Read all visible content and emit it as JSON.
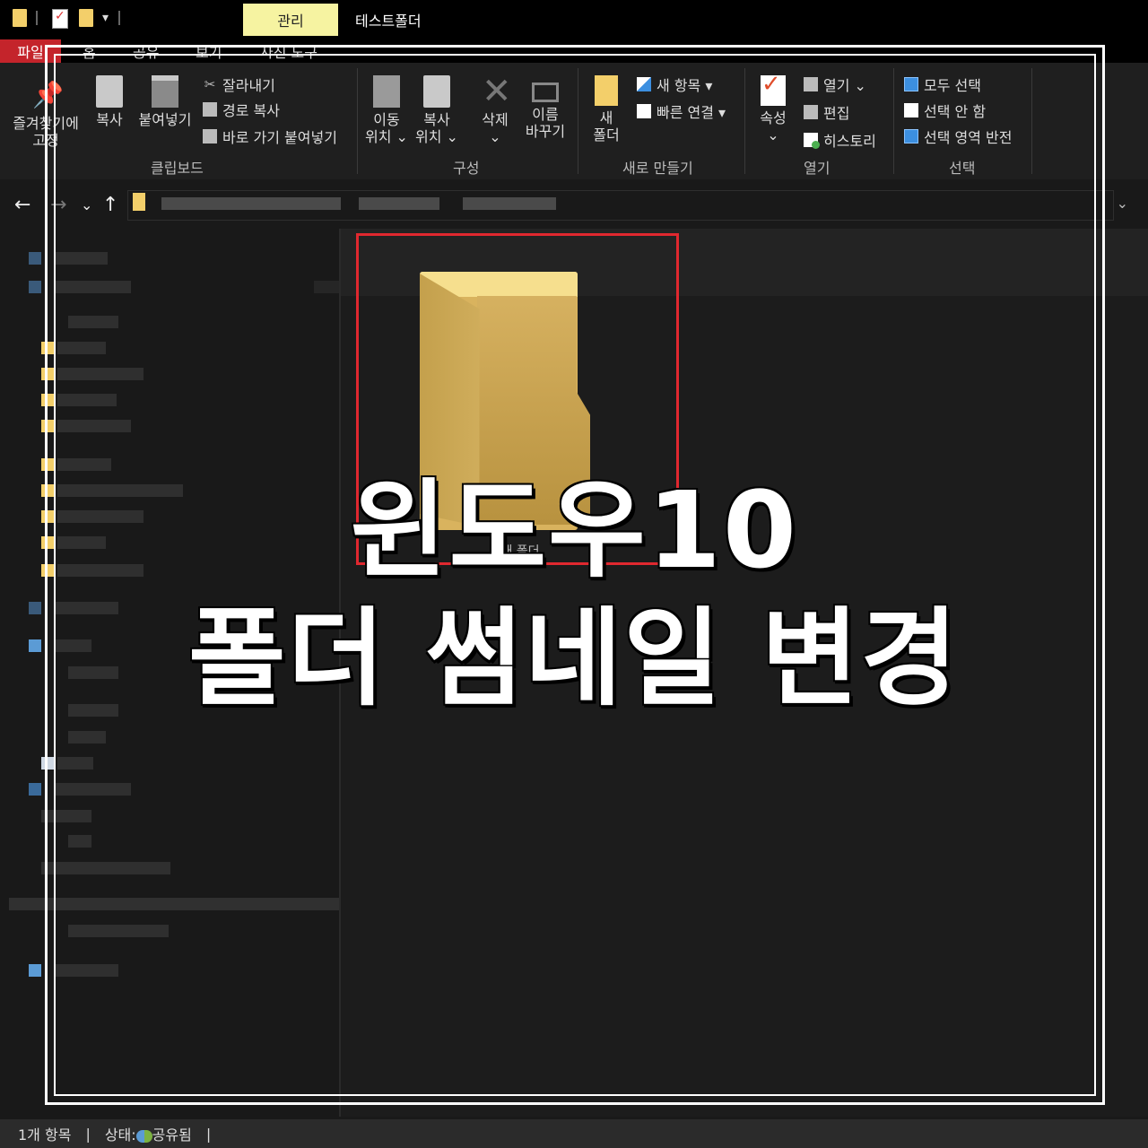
{
  "window": {
    "title": "테스트폴더",
    "context_tab": "관리"
  },
  "tabs": {
    "file": "파일",
    "home": "홈",
    "share": "공유",
    "view": "보기",
    "picture_tools": "사진 도구"
  },
  "ribbon": {
    "clipboard": {
      "label": "클립보드",
      "pin_line1": "즐겨찾기에",
      "pin_line2": "고정",
      "copy": "복사",
      "paste": "붙여넣기",
      "cut": "잘라내기",
      "copy_path": "경로 복사",
      "paste_shortcut": "바로 가기 붙여넣기"
    },
    "organize": {
      "label": "구성",
      "move_line1": "이동",
      "move_line2": "위치 ⌄",
      "copyto_line1": "복사",
      "copyto_line2": "위치 ⌄",
      "delete": "삭제",
      "delete_arrow": "⌄",
      "rename_line1": "이름",
      "rename_line2": "바꾸기"
    },
    "new": {
      "label": "새로 만들기",
      "folder_line1": "새",
      "folder_line2": "폴더",
      "new_item": "새 항목 ▾",
      "easy_access": "빠른 연결 ▾"
    },
    "open": {
      "label": "열기",
      "properties": "속성",
      "properties_arrow": "⌄",
      "open": "열기 ⌄",
      "edit": "편집",
      "history": "히스토리"
    },
    "select": {
      "label": "선택",
      "select_all": "모두 선택",
      "select_none": "선택 안 함",
      "invert": "선택 영역 반전"
    }
  },
  "address": {
    "back": "←",
    "forward": "→",
    "recent": "⌄",
    "up": "↑",
    "dropdown": "⌄"
  },
  "content": {
    "folder_name": "새 폴더"
  },
  "overlay": {
    "line1": "윈도우10",
    "line2": "폴더 썸네일 변경"
  },
  "status": {
    "count": "1개 항목",
    "sep": "|",
    "state": "상태:",
    "shared": "공유됨",
    "sep2": "|"
  },
  "colors": {
    "accent_red": "#e0282f",
    "file_tab": "#c4242b",
    "manage_tab": "#f6f3a1",
    "folder": "#f3cf6a"
  }
}
